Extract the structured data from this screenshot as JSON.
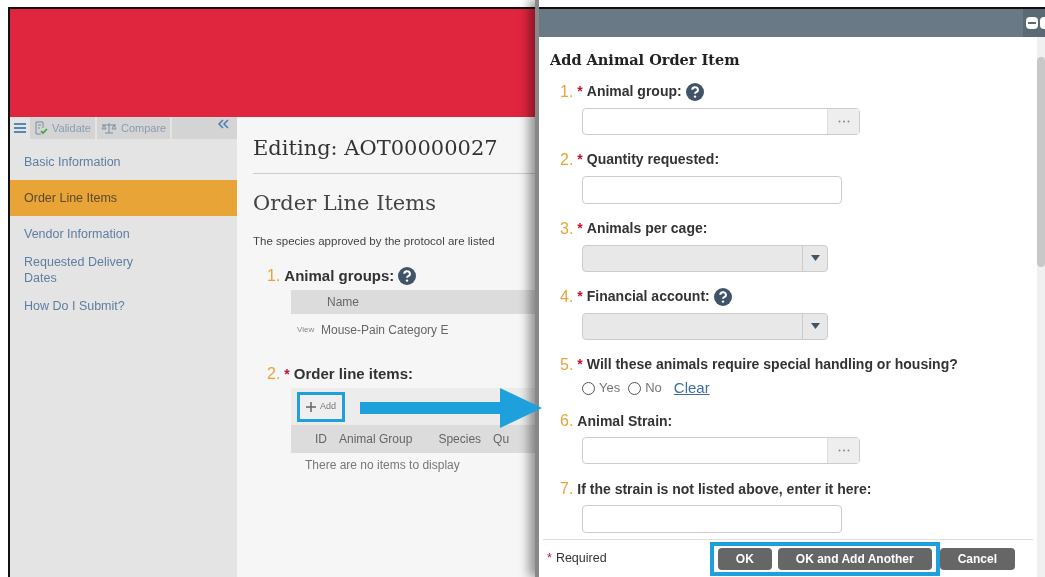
{
  "sidebar": {
    "toolbar": [
      {
        "kind": "validate",
        "label": "Validate"
      },
      {
        "kind": "compare",
        "label": "Compare"
      }
    ],
    "items": [
      {
        "label": "Basic Information",
        "selected": false
      },
      {
        "label": "Order Line Items",
        "selected": true
      },
      {
        "label": "Vendor Information",
        "selected": false
      },
      {
        "label": "Requested Delivery Dates",
        "selected": false
      },
      {
        "label": "How Do I Submit?",
        "selected": false
      }
    ]
  },
  "main": {
    "title": "Editing: AOT00000027",
    "section": "Order Line Items",
    "intro": "The species approved by the protocol are listed",
    "groups": {
      "number": "1.",
      "label": "Animal groups:",
      "help": true,
      "columns": [
        "Name"
      ],
      "rows": [
        {
          "action": "View",
          "name": "Mouse-Pain Category E"
        }
      ]
    },
    "line_items": {
      "number": "2.",
      "asterisk": "*",
      "label": "Order line items:",
      "add_button": {
        "label": "Add",
        "highlighted": true
      },
      "columns": [
        "ID",
        "Animal Group",
        "Species",
        "Qu"
      ],
      "empty": "There are no items to display"
    }
  },
  "dialog": {
    "title": "Add Animal Order Item",
    "fields": [
      {
        "kind": "picker",
        "number": "1.",
        "asterisk": "*",
        "label": "Animal group:",
        "help": true
      },
      {
        "kind": "text",
        "number": "2.",
        "asterisk": "*",
        "label": "Quantity requested:"
      },
      {
        "kind": "select",
        "number": "3.",
        "asterisk": "*",
        "label": "Animals per cage:"
      },
      {
        "kind": "select",
        "number": "4.",
        "asterisk": "*",
        "label": "Financial account:",
        "help": true
      },
      {
        "kind": "radio",
        "number": "5.",
        "asterisk": "*",
        "label": "Will these animals require special handling or housing?",
        "options": [
          {
            "label": "Yes",
            "selected": false
          },
          {
            "label": "No",
            "selected": false
          }
        ],
        "clear": "Clear"
      },
      {
        "kind": "picker",
        "number": "6.",
        "label": "Animal Strain:"
      },
      {
        "kind": "text",
        "number": "7.",
        "label": "If the strain is not listed above, enter it here:"
      }
    ],
    "required_note": {
      "asterisk": "*",
      "text": "Required"
    },
    "buttons": [
      {
        "label": "OK",
        "highlighted": true
      },
      {
        "label": "OK and Add Another",
        "highlighted": true
      },
      {
        "label": "Cancel",
        "highlighted": false
      }
    ]
  }
}
